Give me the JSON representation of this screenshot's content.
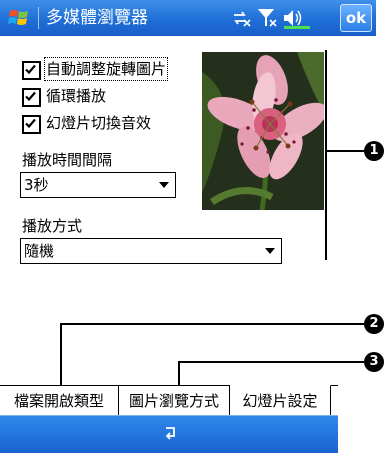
{
  "app": {
    "title": "多媒體瀏覽器",
    "ok_label": "ok"
  },
  "options": {
    "auto_rotate": {
      "label": "自動調整旋轉圖片",
      "checked": true
    },
    "loop_play": {
      "label": "循環播放",
      "checked": true
    },
    "slide_sound": {
      "label": "幻燈片切換音效",
      "checked": true
    }
  },
  "interval": {
    "label": "播放時間間隔",
    "value": "3秒"
  },
  "mode": {
    "label": "播放方式",
    "value": "隨機"
  },
  "callouts": [
    "1",
    "2",
    "3"
  ],
  "tabs": [
    {
      "label": "檔案開啟類型",
      "active": false
    },
    {
      "label": "圖片瀏覽方式",
      "active": false
    },
    {
      "label": "幻燈片設定",
      "active": true
    }
  ],
  "colors": {
    "titlebar": "#1f6fd8",
    "cmdbar": "#1a63d0"
  },
  "icons": {
    "start": "windows-flag-icon",
    "connectivity": "connectivity-icon",
    "signal": "signal-off-icon",
    "volume": "speaker-icon",
    "sip": "keyboard-icon"
  }
}
